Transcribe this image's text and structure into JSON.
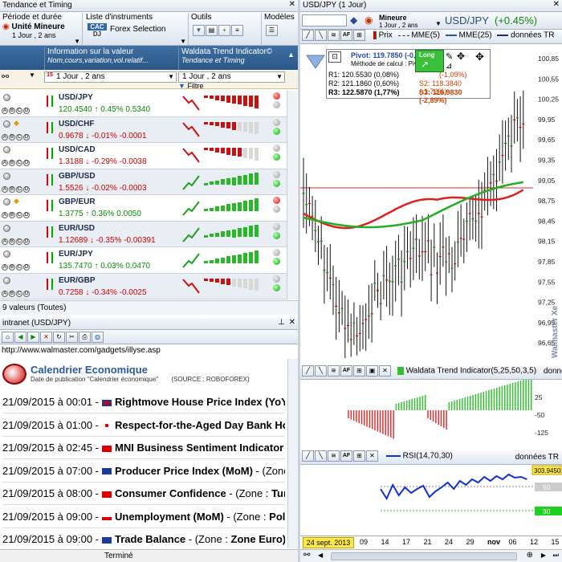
{
  "left": {
    "title": "Tendance et Timing",
    "toolbar": {
      "period_label": "Période et durée",
      "unit_label": "Unité Mineure",
      "unit_value": "1 Jour , 2 ans",
      "list_label": "Liste d'instruments",
      "list_badge_top": "CAC",
      "list_badge_bottom": "DJ",
      "list_value": "Forex Selection",
      "tools_label": "Outils",
      "models_label": "Modèles"
    },
    "grid": {
      "col_info": "Information sur la valeur",
      "col_info_sub": "Nom,cours,variation,vol.relatif...",
      "col_trend": "Waldata Trend Indicator©",
      "col_trend_sub": "Tendance et Timing",
      "period_left": "1 Jour , 2 ans",
      "period_right": "1 Jour , 2 ans",
      "calendar_day": "15",
      "filter": "Filtre"
    },
    "rows": [
      {
        "symbol": "USD/JPY",
        "price": "120.4540",
        "arrow": "↑",
        "pct": "0.45%",
        "chg": "0.5340",
        "dir": "up",
        "trend": "down",
        "light": "red",
        "bars": [
          1,
          1,
          1,
          1,
          1,
          1,
          1,
          1,
          1,
          1
        ]
      },
      {
        "symbol": "USD/CHF",
        "price": "0.9678",
        "arrow": "↓",
        "pct": "-0.01%",
        "chg": "-0.0001",
        "dir": "dn",
        "trend": "down",
        "light": "green",
        "bars": [
          1,
          1,
          1,
          1,
          1,
          1,
          0,
          0,
          0,
          0
        ]
      },
      {
        "symbol": "USD/CAD",
        "price": "1.3188",
        "arrow": "↓",
        "pct": "-0.29%",
        "chg": "-0.0038",
        "dir": "dn",
        "trend": "down",
        "light": "green",
        "bars": [
          1,
          1,
          1,
          1,
          1,
          1,
          1,
          0,
          0,
          0
        ]
      },
      {
        "symbol": "GBP/USD",
        "price": "1.5526",
        "arrow": "↓",
        "pct": "-0.02%",
        "chg": "-0.0003",
        "dir": "dn",
        "trend": "up",
        "light": "green",
        "bars": [
          2,
          2,
          2,
          2,
          2,
          2,
          2,
          2,
          2,
          2
        ]
      },
      {
        "symbol": "GBP/EUR",
        "price": "1.3775",
        "arrow": "↑",
        "pct": "0.36%",
        "chg": "0.0050",
        "dir": "up",
        "trend": "up",
        "light": "red",
        "bars": [
          2,
          2,
          2,
          2,
          2,
          2,
          2,
          2,
          2,
          2
        ]
      },
      {
        "symbol": "EUR/USD",
        "price": "1.12689",
        "arrow": "↓",
        "pct": "-0.35%",
        "chg": "-0.00391",
        "dir": "dn",
        "trend": "up",
        "light": "green",
        "bars": [
          2,
          2,
          2,
          2,
          2,
          2,
          2,
          2,
          2,
          2
        ]
      },
      {
        "symbol": "EUR/JPY",
        "price": "135.7470",
        "arrow": "↑",
        "pct": "0.03%",
        "chg": "0.0470",
        "dir": "up",
        "trend": "up",
        "light": "green",
        "bars": [
          2,
          2,
          2,
          2,
          2,
          2,
          2,
          2,
          2,
          2
        ]
      },
      {
        "symbol": "EUR/GBP",
        "price": "0.7258",
        "arrow": "↓",
        "pct": "-0.34%",
        "chg": "-0.0025",
        "dir": "dn",
        "trend": "down",
        "light": "green",
        "bars": [
          1,
          1,
          1,
          1,
          1,
          0,
          0,
          0,
          0,
          0
        ]
      }
    ],
    "count": "9 valeurs (Toutes)"
  },
  "browser": {
    "title": "intranet (USD/JPY)",
    "url": "http://www.walmaster.com/gadgets/illyse.asp",
    "cal_title": "Calendrier Economique",
    "cal_sub": "Date de publication \"Calendrier économique\"",
    "cal_source": "(SOURCE : ROBOFOREX)",
    "events": [
      {
        "date": "21/09/2015 à 00:01 -",
        "flag": "uk",
        "name": "Rightmove House Price Index (YoY"
      },
      {
        "date": "21/09/2015 à 01:00 -",
        "flag": "jp",
        "name": "Respect-for-the-Aged Day Bank Ho"
      },
      {
        "date": "21/09/2015 à 02:45 -",
        "flag": "cn",
        "name": "MNI Business Sentiment Indicator"
      },
      {
        "date": "21/09/2015 à 07:00 -",
        "flag": "eu",
        "name": "Producer Price Index (MoM)",
        "zone_prefix": "- (Zone"
      },
      {
        "date": "21/09/2015 à 08:00 -",
        "flag": "tr",
        "name": "Consumer Confidence",
        "zone_prefix": "- (Zone :",
        "zone": "Tur"
      },
      {
        "date": "21/09/2015 à 09:00 -",
        "flag": "pl",
        "name": "Unemployment (MoM)",
        "zone_prefix": "- (Zone :",
        "zone": "Polo"
      },
      {
        "date": "21/09/2015 à 09:00 -",
        "flag": "eu",
        "name": "Trade Balance",
        "zone_prefix": "- (Zone :",
        "zone": "Zone Euro)"
      }
    ],
    "status": "Terminé"
  },
  "right": {
    "title": "USD/JPY (1 Jour)",
    "unit": "Mineure",
    "unit_sub": "1 Jour , 2 ans",
    "symbol": "USD/JPY",
    "change": "(+0.45%)",
    "legend": {
      "price": "Prix",
      "mme5": "MME(5)",
      "mme25": "MME(25)",
      "data": "données TR"
    },
    "pivot": {
      "title": "Pivot: 119.7850 (-0,",
      "method": "Méthode de calcul : Piv",
      "r1": "R1: 120.5530 (0,08%)",
      "r2": "R2: 121.1860 (0,60%)",
      "r3": "R3: 122.5870 (1,77%)",
      "s1": "(-1,09%)",
      "s2": "S2: 118.3840 (-1,72%)",
      "s3": "S3: 116.9830 (-2,89%)",
      "long": "Long"
    },
    "price_labels": [
      "100,85",
      "100,55",
      "100,25",
      "99,95",
      "99,65",
      "99,35",
      "99,05",
      "98,75",
      "98,45",
      "98,15",
      "97,85",
      "97,55",
      "97,25",
      "96,95",
      "96,65"
    ],
    "watermark": "Walmaster Xe",
    "wti": {
      "title": "Waldata Trend Indicator(5,25,50,3,5)",
      "data": "données TR",
      "labels": [
        "25",
        "-50",
        "-125"
      ]
    },
    "rsi": {
      "title": "RSI(14,70,30)",
      "data": "données TR",
      "value": "303.9450",
      "labels": [
        "50",
        "30"
      ]
    },
    "date_axis": {
      "current": "24 sept. 2013",
      "ticks": [
        "09",
        "14",
        "17",
        "21",
        "24",
        "29",
        "nov",
        "06",
        "12",
        "15",
        "20"
      ]
    }
  },
  "colors": {
    "accent": "#2a5687",
    "up": "#0a8a0a",
    "down": "#d00000",
    "ma_red": "#e02020",
    "ma_green": "#20b020"
  }
}
